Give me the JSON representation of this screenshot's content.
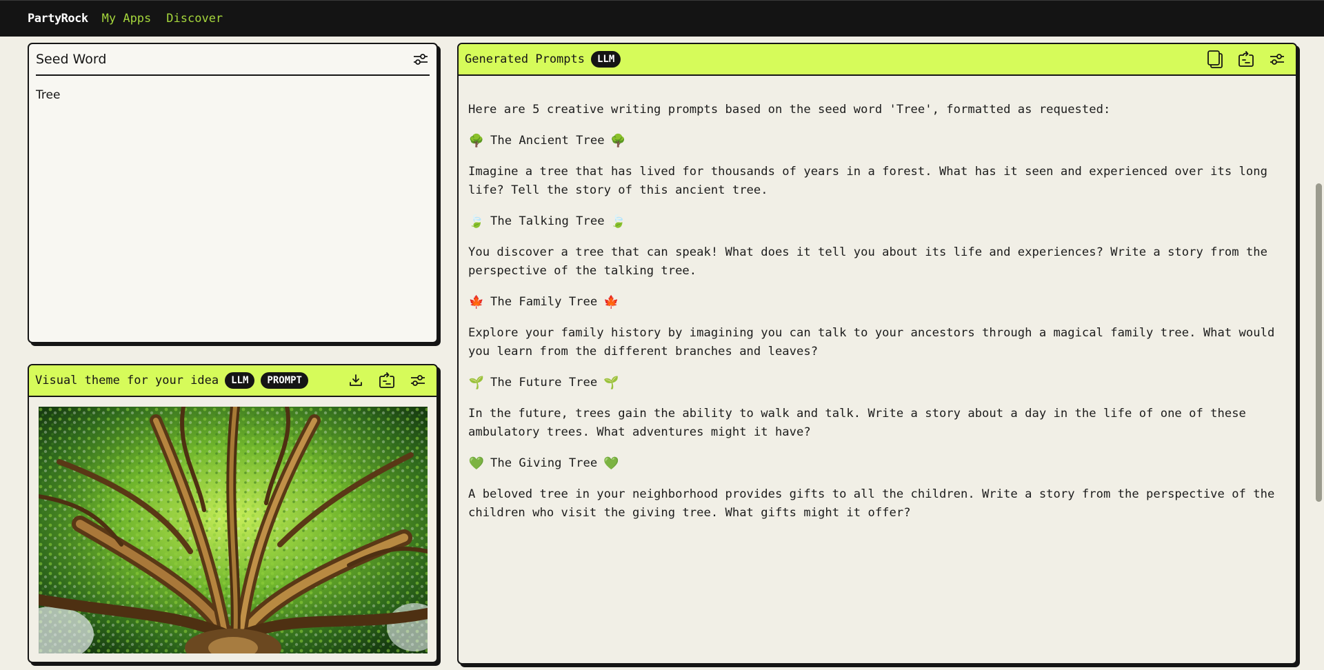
{
  "nav": {
    "brand": "PartyRock",
    "links": [
      {
        "label": "My Apps"
      },
      {
        "label": "Discover"
      }
    ],
    "link_color": "#a5d63c"
  },
  "seed_word": {
    "title": "Seed Word",
    "value": "Tree",
    "settings_icon": "sliders-icon"
  },
  "visual_theme": {
    "title": "Visual theme for your idea",
    "badges": [
      "LLM",
      "PROMPT"
    ],
    "icons": [
      "download-icon",
      "move-to-icon",
      "sliders-icon"
    ],
    "image_alt": "Looking up into the canopy of a large tree with sprawling brown branches and green leaves"
  },
  "generated_prompts": {
    "title": "Generated Prompts",
    "badge": "LLM",
    "icons": [
      "copy-icon",
      "move-to-icon",
      "sliders-icon"
    ],
    "intro": "Here are 5 creative writing prompts based on the seed word 'Tree', formatted as requested:",
    "prompts": [
      {
        "emoji": "🌳",
        "title": "The Ancient Tree",
        "body": "Imagine a tree that has lived for thousands of years in a forest. What has it seen and experienced over its long life? Tell the story of this ancient tree."
      },
      {
        "emoji": "🍃",
        "title": "The Talking Tree",
        "body": "You discover a tree that can speak! What does it tell you about its life and experiences? Write a story from the perspective of the talking tree."
      },
      {
        "emoji": "🍁",
        "title": "The Family Tree",
        "body": "Explore your family history by imagining you can talk to your ancestors through a magical family tree. What would you learn from the different branches and leaves?"
      },
      {
        "emoji": "🌱",
        "title": "The Future Tree",
        "body": "In the future, trees gain the ability to walk and talk. Write a story about a day in the life of one of these ambulatory trees. What adventures might it have?"
      },
      {
        "emoji": "💚",
        "title": "The Giving Tree",
        "body": "A beloved tree in your neighborhood provides gifts to all the children. Write a story from the perspective of the children who visit the giving tree. What gifts might it offer?"
      }
    ]
  },
  "colors": {
    "accent_lime": "#d6fb5a",
    "dark": "#151515",
    "background": "#f1efe6"
  }
}
